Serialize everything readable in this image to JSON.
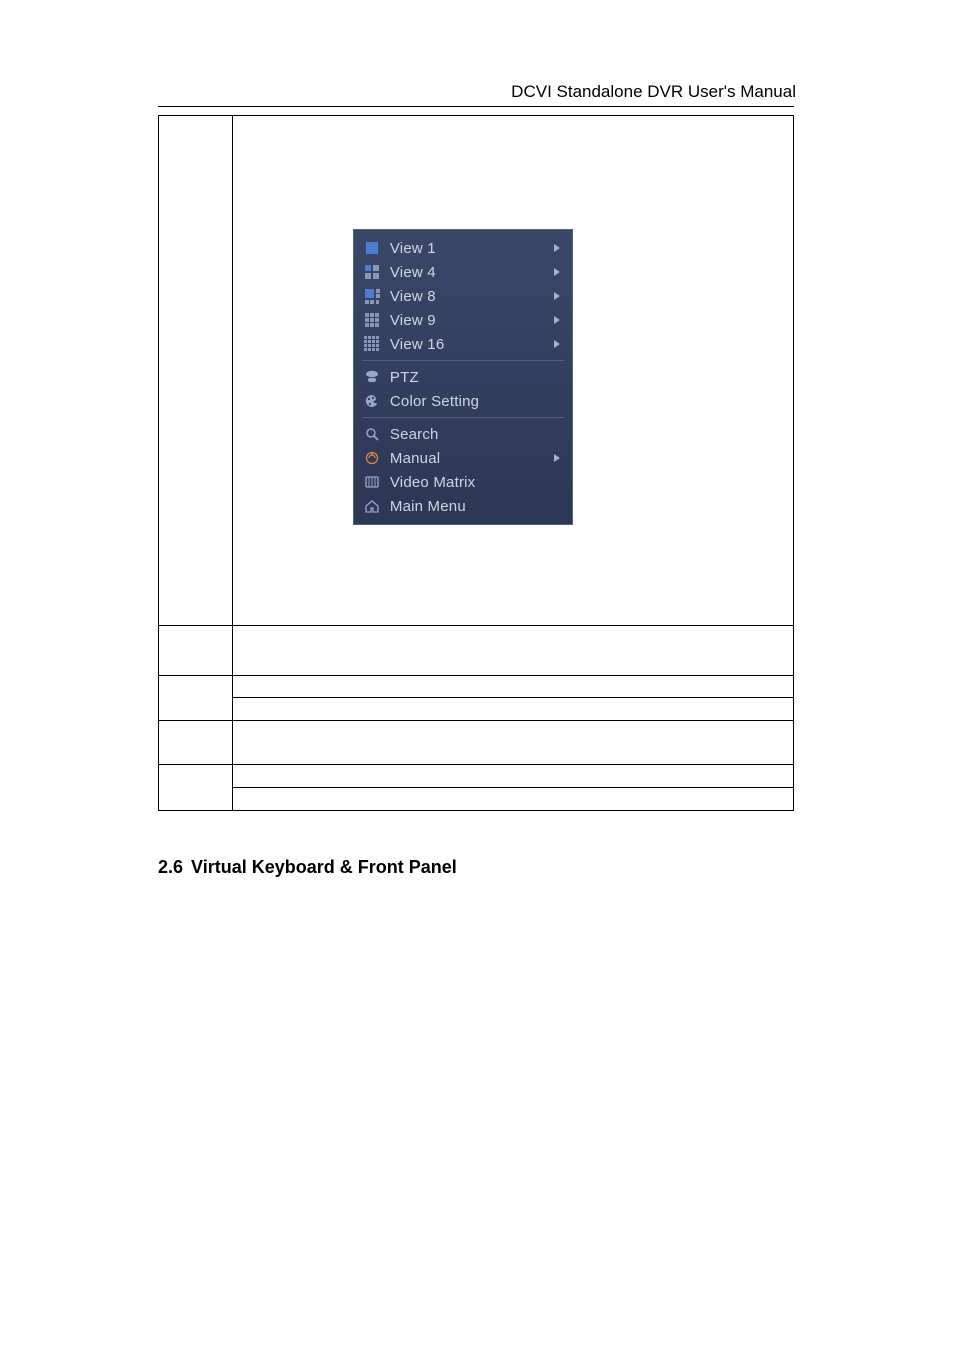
{
  "header": {
    "title": "DCVI Standalone DVR User's Manual"
  },
  "menu": {
    "groups": [
      {
        "items": [
          {
            "icon": "view1-icon",
            "label": "View 1",
            "has_submenu": true
          },
          {
            "icon": "view4-icon",
            "label": "View 4",
            "has_submenu": true
          },
          {
            "icon": "view8-icon",
            "label": "View 8",
            "has_submenu": true
          },
          {
            "icon": "view9-icon",
            "label": "View 9",
            "has_submenu": true
          },
          {
            "icon": "view16-icon",
            "label": "View 16",
            "has_submenu": true
          }
        ]
      },
      {
        "items": [
          {
            "icon": "ptz-icon",
            "label": "PTZ",
            "has_submenu": false
          },
          {
            "icon": "color-setting-icon",
            "label": "Color Setting",
            "has_submenu": false
          }
        ]
      },
      {
        "items": [
          {
            "icon": "search-icon",
            "label": "Search",
            "has_submenu": false
          },
          {
            "icon": "manual-icon",
            "label": "Manual",
            "has_submenu": true
          },
          {
            "icon": "video-matrix-icon",
            "label": "Video Matrix",
            "has_submenu": false
          },
          {
            "icon": "main-menu-icon",
            "label": "Main Menu",
            "has_submenu": false
          }
        ]
      }
    ]
  },
  "section": {
    "number": "2.6",
    "title": "Virtual Keyboard & Front Panel"
  }
}
